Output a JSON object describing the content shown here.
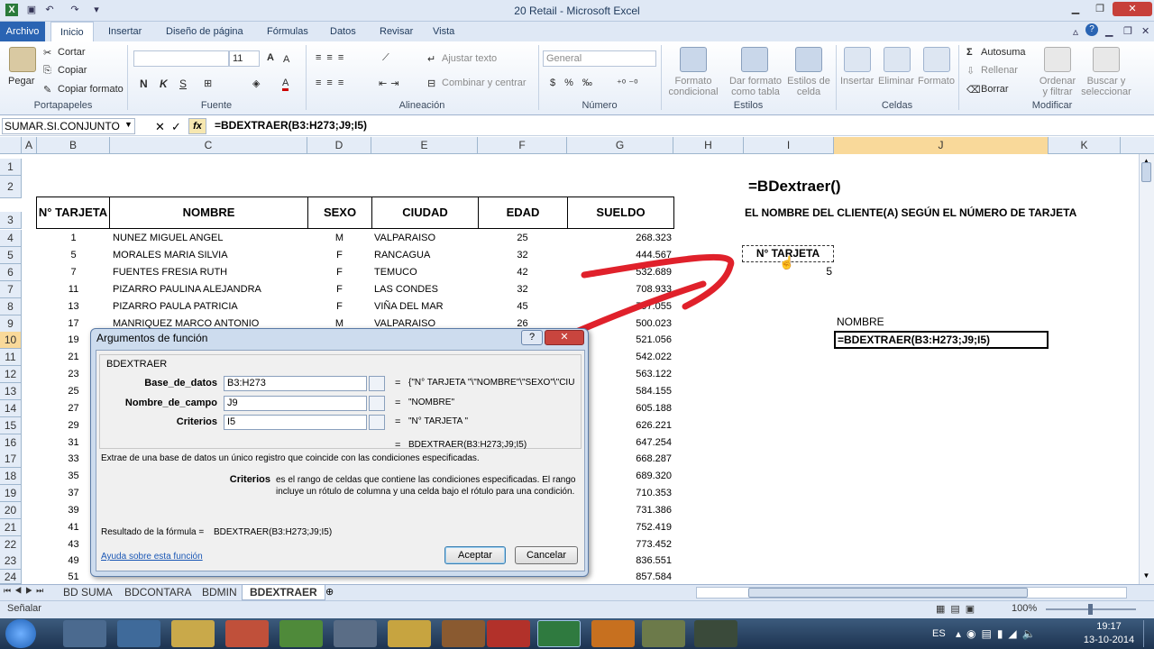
{
  "window": {
    "title": "20 Retail  -  Microsoft Excel"
  },
  "tabs": [
    "Archivo",
    "Inicio",
    "Insertar",
    "Diseño de página",
    "Fórmulas",
    "Datos",
    "Revisar",
    "Vista"
  ],
  "ribbon": {
    "clipboard": {
      "paste": "Pegar",
      "cut": "Cortar",
      "copy": "Copiar",
      "format_painter": "Copiar formato",
      "label": "Portapapeles"
    },
    "font": {
      "size": "11",
      "bold": "N",
      "italic": "K",
      "underline": "S",
      "label": "Fuente"
    },
    "alignment": {
      "wrap": "Ajustar texto",
      "merge": "Combinar y centrar",
      "label": "Alineación"
    },
    "number": {
      "format": "General",
      "label": "Número"
    },
    "styles": {
      "conditional": "Formato condicional",
      "table": "Dar formato como tabla",
      "cell": "Estilos de celda",
      "label": "Estilos"
    },
    "cells": {
      "insert": "Insertar",
      "delete": "Eliminar",
      "format": "Formato",
      "label": "Celdas"
    },
    "editing": {
      "autosum": "Autosuma",
      "fill": "Rellenar",
      "clear": "Borrar",
      "sort": "Ordenar y filtrar",
      "find": "Buscar y seleccionar",
      "label": "Modificar"
    }
  },
  "formula_bar": {
    "name_box": "SUMAR.SI.CONJUNTO",
    "fx": "fx",
    "formula": "=BDEXTRAER(B3:H273;J9;I5)"
  },
  "columns": [
    "A",
    "B",
    "C",
    "D",
    "E",
    "F",
    "G",
    "H",
    "I",
    "J",
    "K"
  ],
  "rows": [
    "1",
    "2",
    "3",
    "4",
    "5",
    "6",
    "7",
    "8",
    "9",
    "10",
    "11",
    "12",
    "13",
    "14",
    "15",
    "16",
    "17",
    "18",
    "19",
    "20",
    "21",
    "22",
    "23",
    "24"
  ],
  "table": {
    "headers": [
      "N° TARJETA",
      "NOMBRE",
      "SEXO",
      "CIUDAD",
      "EDAD",
      "SUELDO"
    ],
    "data": [
      [
        "1",
        "NUNEZ   MIGUEL ANGEL",
        "M",
        "VALPARAISO",
        "25",
        "268.323"
      ],
      [
        "5",
        "MORALES   MARIA SILVIA",
        "F",
        "RANCAGUA",
        "32",
        "444.567"
      ],
      [
        "7",
        "FUENTES   FRESIA RUTH",
        "F",
        "TEMUCO",
        "42",
        "532.689"
      ],
      [
        "11",
        "PIZARRO   PAULINA ALEJANDRA",
        "F",
        "LAS CONDES",
        "32",
        "708.933"
      ],
      [
        "13",
        "PIZARRO   PAULA PATRICIA",
        "F",
        "VIÑA DEL MAR",
        "45",
        "797.055"
      ],
      [
        "17",
        "MANRIQUEZ   MARCO ANTONIO",
        "M",
        "VALPARAISO",
        "26",
        "500.023"
      ]
    ],
    "id_column": [
      "19",
      "21",
      "23",
      "25",
      "27",
      "29",
      "31",
      "33",
      "35",
      "37",
      "39",
      "41",
      "43",
      "49",
      "51"
    ],
    "salary_column": [
      "521.056",
      "542.022",
      "563.122",
      "584.155",
      "605.188",
      "626.221",
      "647.254",
      "668.287",
      "689.320",
      "710.353",
      "731.386",
      "752.419",
      "773.452",
      "836.551",
      "857.584"
    ]
  },
  "right_panel": {
    "title": "=BDextraer()",
    "subtitle": "EL  NOMBRE DEL CLIENTE(A)  SEGÚN EL NÚMERO DE TARJETA",
    "criteria_header": "N° TARJETA",
    "criteria_value": "5",
    "result_label": "NOMBRE",
    "result_formula": "=BDEXTRAER(B3:H273;J9;I5)"
  },
  "dialog": {
    "title": "Argumentos de función",
    "function_name": "BDEXTRAER",
    "args": [
      {
        "label": "Base_de_datos",
        "value": "B3:H273",
        "result": "{\"N° TARJETA \"\\\"NOMBRE\"\\\"SEXO\"\\\"CIU"
      },
      {
        "label": "Nombre_de_campo",
        "value": "J9",
        "result": "\"NOMBRE\""
      },
      {
        "label": "Criterios",
        "value": "I5",
        "result": "\"N° TARJETA \""
      }
    ],
    "eq": "=",
    "formula_result": "BDEXTRAER(B3:H273;J9;I5)",
    "description": "Extrae de una base de datos un único registro que coincide con las condiciones especificadas.",
    "arg_name": "Criterios",
    "arg_description": "es el rango de celdas que contiene las condiciones especificadas. El rango incluye un rótulo de columna y una celda bajo el rótulo para una condición.",
    "result_label": "Resultado de la fórmula =",
    "result_value": "BDEXTRAER(B3:H273;J9;I5)",
    "help_link": "Ayuda sobre esta función",
    "ok": "Aceptar",
    "cancel": "Cancelar"
  },
  "sheet_tabs": [
    "BD SUMA",
    "BDCONTARA",
    "BDMIN",
    "BDEXTRAER"
  ],
  "status": {
    "mode": "Señalar",
    "zoom": "100%"
  },
  "taskbar": {
    "lang": "ES",
    "time": "19:17",
    "date": "13-10-2014"
  },
  "colors": {
    "accent": "#2a64b3",
    "arrow": "#e0212b",
    "selected_col": "#f9d99a"
  }
}
